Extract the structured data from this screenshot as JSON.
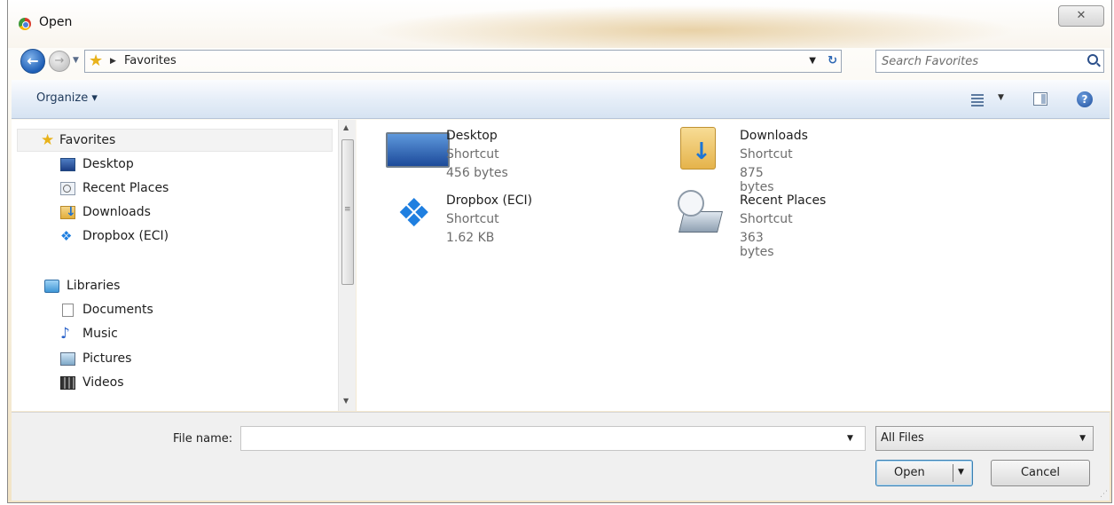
{
  "window": {
    "title": "Open",
    "close_glyph": "✕"
  },
  "nav": {
    "back_glyph": "←",
    "forward_glyph": "→",
    "address_path": "Favorites",
    "search_placeholder": "Search Favorites"
  },
  "toolbar": {
    "organize_label": "Organize ▾",
    "help_glyph": "?"
  },
  "sidebar": {
    "favorites_header": "Favorites",
    "favorites": [
      {
        "label": "Desktop",
        "icon": "desktop-icon"
      },
      {
        "label": "Recent Places",
        "icon": "recent-places-icon"
      },
      {
        "label": "Downloads",
        "icon": "downloads-folder-icon"
      },
      {
        "label": "Dropbox (ECI)",
        "icon": "dropbox-icon"
      }
    ],
    "libraries_header": "Libraries",
    "libraries": [
      {
        "label": "Documents",
        "icon": "documents-icon"
      },
      {
        "label": "Music",
        "icon": "music-icon"
      },
      {
        "label": "Pictures",
        "icon": "pictures-icon"
      },
      {
        "label": "Videos",
        "icon": "videos-icon"
      }
    ]
  },
  "files": [
    {
      "name": "Desktop",
      "type": "Shortcut",
      "size": "456 bytes",
      "icon": "desktop-monitor-icon"
    },
    {
      "name": "Downloads",
      "type": "Shortcut",
      "size": "875 bytes",
      "icon": "downloads-folder-icon"
    },
    {
      "name": "Dropbox (ECI)",
      "type": "Shortcut",
      "size": "1.62 KB",
      "icon": "dropbox-icon"
    },
    {
      "name": "Recent Places",
      "type": "Shortcut",
      "size": "363 bytes",
      "icon": "recent-places-icon"
    }
  ],
  "footer": {
    "file_name_label": "File name:",
    "file_name_value": "",
    "file_type_selected": "All Files",
    "open_label": "Open",
    "cancel_label": "Cancel"
  },
  "colors": {
    "accent": "#1f5fb6",
    "toolbar_bg": "#dde8f5",
    "title_glow": "#e2c48c"
  }
}
